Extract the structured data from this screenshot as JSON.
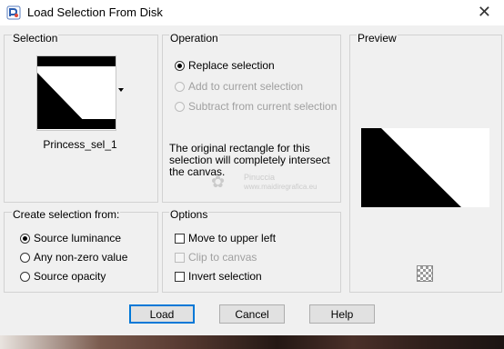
{
  "window": {
    "title": "Load Selection From Disk",
    "close_glyph": "✕"
  },
  "selection": {
    "label": "Selection",
    "name": "Princess_sel_1"
  },
  "operation": {
    "label": "Operation",
    "options": [
      {
        "label": "Replace selection",
        "checked": true,
        "enabled": true
      },
      {
        "label": "Add to current selection",
        "checked": false,
        "enabled": false
      },
      {
        "label": "Subtract from current selection",
        "checked": false,
        "enabled": false
      }
    ],
    "note": "The original rectangle for this selection will completely intersect the canvas."
  },
  "preview": {
    "label": "Preview"
  },
  "create_from": {
    "label": "Create selection from:",
    "options": [
      {
        "label": "Source luminance",
        "checked": true
      },
      {
        "label": "Any non-zero value",
        "checked": false
      },
      {
        "label": "Source opacity",
        "checked": false
      }
    ]
  },
  "options": {
    "label": "Options",
    "checks": [
      {
        "label": "Move to upper left",
        "checked": false,
        "enabled": true
      },
      {
        "label": "Clip to canvas",
        "checked": false,
        "enabled": false
      },
      {
        "label": "Invert selection",
        "checked": false,
        "enabled": true
      }
    ]
  },
  "buttons": {
    "load": "Load",
    "cancel": "Cancel",
    "help": "Help"
  },
  "watermark": {
    "line1": "Pinuccia",
    "line2": "www.maidiregrafica.eu"
  },
  "icons": {
    "app": "psp-app-icon",
    "close": "close-icon",
    "dropdown": "chevron-down-icon",
    "checker": "checkerboard-icon"
  }
}
